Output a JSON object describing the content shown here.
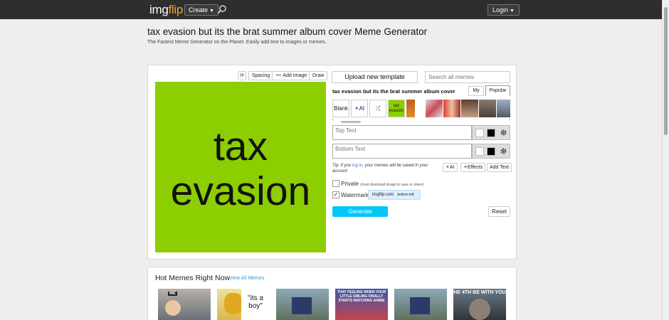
{
  "nav": {
    "logo_main": "img",
    "logo_accent": "flip",
    "create_label": "Create",
    "login_label": "Login"
  },
  "page": {
    "title": "tax evasion but its the brat summer album cover Meme Generator",
    "subtitle": "The Fastest Meme Generator on the Planet. Easily add text to images or memes."
  },
  "toolbar": {
    "spacing_label": "Spacing",
    "add_image_label": "Add Image",
    "draw_label": "Draw"
  },
  "meme": {
    "line1": "tax",
    "line2": "evasion",
    "background_color": "#8cce00"
  },
  "side": {
    "upload_label": "Upload new template",
    "search_placeholder": "Search all memes",
    "template_name": "tax evasion but its the brat summer album cover",
    "tab_my": "My",
    "tab_popular": "Popular",
    "blank_label": "Blank",
    "ai_label": "AI",
    "thumb_tax": "tax evasion"
  },
  "inputs": {
    "top_placeholder": "Top Text",
    "bottom_placeholder": "Bottom Text"
  },
  "tip": {
    "prefix": "Tip: If you ",
    "link": "log in",
    "suffix": ", your memes will be saved in your account"
  },
  "actions": {
    "ai_label": "AI",
    "effects_label": "Effects",
    "add_text_label": "Add Text"
  },
  "options": {
    "private_label": "Private",
    "private_note": "(must download image to save or share)",
    "watermark_label": "Watermark",
    "watermark_site": "imgflip.com",
    "watermark_pos": "bottom left",
    "watermark_checked": true
  },
  "buttons": {
    "generate_label": "Generate",
    "reset_label": "Reset"
  },
  "hot": {
    "title": "Hot Memes Right Now",
    "view_all": "View All Memes",
    "thumb1_caption": "ME",
    "thumb3_caption": "\"its a boy\"",
    "thumb5_caption": "THAT FEELING WHEN YOUR LITTLE SIBLING FINALLY STARTS WATCHING ANIME",
    "thumb7_caption": "HE 4TH BE WITH YOU"
  },
  "colors": {
    "nav_bg": "#2e2e2e",
    "logo_accent": "#f5a623",
    "generate_bg": "#04c6f9",
    "link": "#2a7ae2"
  }
}
